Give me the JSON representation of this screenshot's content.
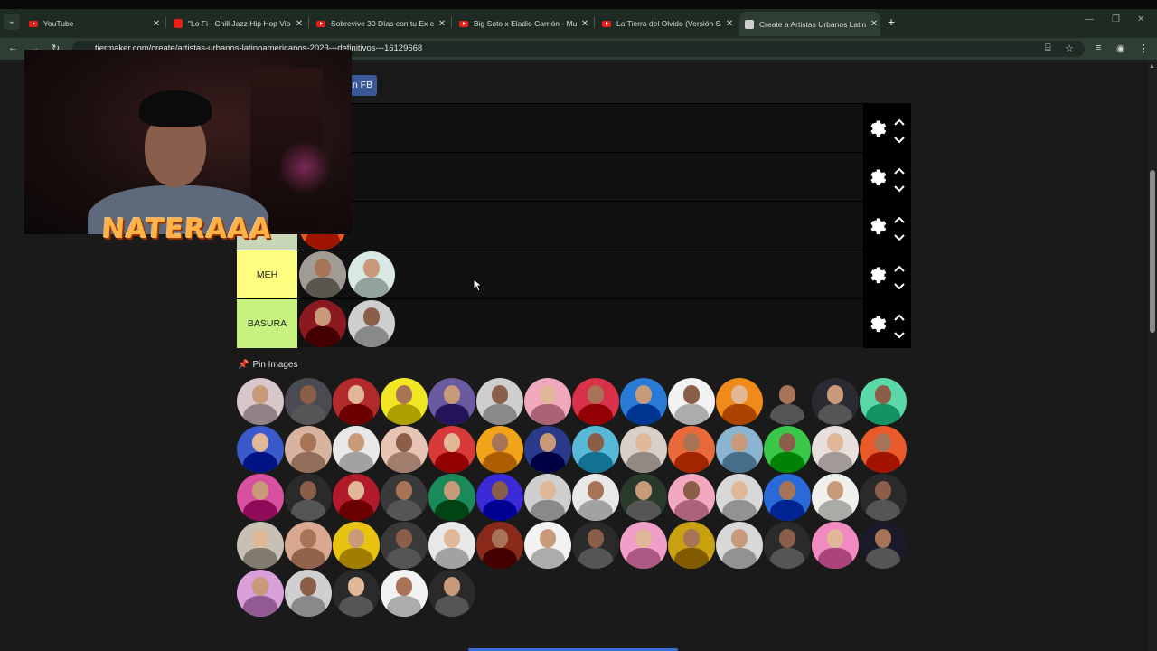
{
  "browser": {
    "tabs": [
      {
        "title": "YouTube",
        "icon": "youtube-icon"
      },
      {
        "title": "\"Lo Fi - Chill Jazz Hip Hop Vibes",
        "icon": "youtube-music-icon"
      },
      {
        "title": "Sobrevive 30 Días con tu Ex en M",
        "icon": "youtube-icon"
      },
      {
        "title": "Big Soto x Eladio Carrión - Mula",
        "icon": "youtube-icon"
      },
      {
        "title": "La Tierra del Olvido (Versión Sa",
        "icon": "youtube-icon"
      },
      {
        "title": "Create a Artistas Urbanos Latino",
        "icon": "tiermaker-icon",
        "active": true
      }
    ],
    "url": "tiermaker.com/create/artistas-urbanos-latinoamericanos-2023---definitivos---16129668"
  },
  "page": {
    "fb_button": "n FB",
    "tiers": [
      {
        "label": "",
        "color": "#111111",
        "items": []
      },
      {
        "label": "",
        "color": "#111111",
        "items": [
          "#2a1a14"
        ]
      },
      {
        "label": "",
        "color": "#c9d7b8",
        "items": [
          "#e35a1c"
        ]
      },
      {
        "label": "MEH",
        "color": "#fdfd80",
        "items": [
          "#a09c94",
          "#d8e8e4"
        ]
      },
      {
        "label": "BASURA",
        "color": "#c8f280",
        "items": [
          "#8a1a20",
          "#cfcfcf"
        ]
      }
    ],
    "pin_label": "Pin Images",
    "pool_colors": [
      "#d8c8cc",
      "#4a4a52",
      "#b22a2a",
      "#f2e624",
      "#6a5aa0",
      "#cfcfcf",
      "#f0a8bc",
      "#d8324a",
      "#2a7ad8",
      "#f2f2f2",
      "#f08a1a",
      "#1a1a1a",
      "#2a2a32",
      "#5ad8a8",
      "#3a5acc",
      "#d8b4a0",
      "#e8e8e8",
      "#e8c4b4",
      "#d83a3a",
      "#f2a418",
      "#2a3a8a",
      "#58b8d8",
      "#d8d0c8",
      "#e86a3a",
      "#8ab4d0",
      "#3ac84a",
      "#e8e0dc",
      "#e85a2a",
      "#d850a0",
      "#2a2a2a",
      "#b01a2a",
      "#3a3a3a",
      "#1a8a5a",
      "#3a2ad8",
      "#cfcfcf",
      "#e8e8e8",
      "#2a3a2a",
      "#f2a8c0",
      "#d8d8d8",
      "#2a6ad8",
      "#f0f0ec",
      "#2a2a2a",
      "#c8c0b4",
      "#d8a890",
      "#e8c410",
      "#3a3a3a",
      "#e8e8e8",
      "#8a2a1a",
      "#f2f2f2",
      "#2a2a2a",
      "#f0a0c8",
      "#c8a010",
      "#d8d8d8",
      "#2a2a2a",
      "#f08ac0",
      "#1a1a2a",
      "#d8a0d8",
      "#cfcfcf",
      "#2a2a2a",
      "#f2f2f2",
      "#2a2a2a"
    ]
  },
  "overlay": {
    "channel_name": "NATERAAA"
  }
}
